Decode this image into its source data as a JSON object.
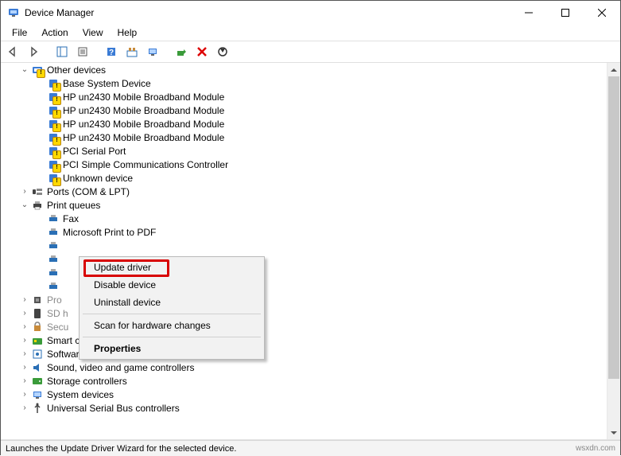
{
  "window": {
    "title": "Device Manager"
  },
  "menu": {
    "file": "File",
    "action": "Action",
    "view": "View",
    "help": "Help"
  },
  "tree": {
    "other_devices": {
      "label": "Other devices",
      "items": [
        "Base System Device",
        "HP un2430 Mobile Broadband Module",
        "HP un2430 Mobile Broadband Module",
        "HP un2430 Mobile Broadband Module",
        "HP un2430 Mobile Broadband Module",
        "PCI Serial Port",
        "PCI Simple Communications Controller",
        "Unknown device"
      ]
    },
    "ports": {
      "label": "Ports (COM & LPT)"
    },
    "print_queues": {
      "label": "Print queues",
      "items": [
        "Fax",
        "Microsoft Print to PDF"
      ]
    },
    "processors": {
      "label": "Pro"
    },
    "sd_host": {
      "label": "SD h"
    },
    "security": {
      "label": "Secu"
    },
    "smart_card": {
      "label": "Smart card readers"
    },
    "software": {
      "label": "Software devices"
    },
    "sound": {
      "label": "Sound, video and game controllers"
    },
    "storage": {
      "label": "Storage controllers"
    },
    "system": {
      "label": "System devices"
    },
    "usb": {
      "label": "Universal Serial Bus controllers"
    }
  },
  "context_menu": {
    "update": "Update driver",
    "disable": "Disable device",
    "uninstall": "Uninstall device",
    "scan": "Scan for hardware changes",
    "properties": "Properties"
  },
  "status": "Launches the Update Driver Wizard for the selected device.",
  "credit": "wsxdn.com"
}
